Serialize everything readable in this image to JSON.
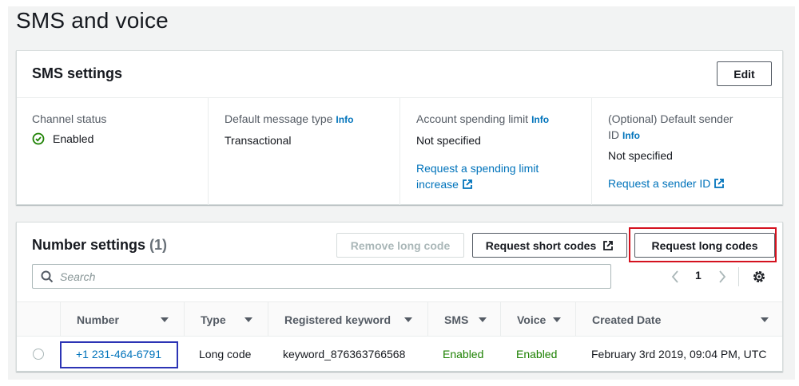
{
  "page": {
    "title": "SMS and voice"
  },
  "sms_settings": {
    "title": "SMS settings",
    "edit_label": "Edit",
    "channel_status": {
      "label": "Channel status",
      "value": "Enabled"
    },
    "default_message_type": {
      "label": "Default message type",
      "info": "Info",
      "value": "Transactional"
    },
    "spending_limit": {
      "label": "Account spending limit",
      "info": "Info",
      "value": "Not specified",
      "link_line1": "Request a spending limit",
      "link_line2": "increase"
    },
    "sender_id": {
      "label_line1": "(Optional) Default sender",
      "label_line2": "ID",
      "info": "Info",
      "value": "Not specified",
      "link": "Request a sender ID"
    }
  },
  "number_settings": {
    "title": "Number settings",
    "count": "(1)",
    "remove_label": "Remove long code",
    "request_short_label": "Request short codes",
    "request_long_label": "Request long codes",
    "search_placeholder": "Search",
    "page": "1",
    "columns": [
      "Number",
      "Type",
      "Registered keyword",
      "SMS",
      "Voice",
      "Created Date"
    ],
    "rows": [
      {
        "number": "+1 231-464-6791",
        "type": "Long code",
        "keyword": "keyword_876363766568",
        "sms": "Enabled",
        "voice": "Enabled",
        "created": "February 3rd 2019, 09:04 PM, UTC"
      }
    ]
  },
  "colors": {
    "link": "#0073bb",
    "success": "#1d8102",
    "highlight_red": "#d4121f",
    "highlight_blue": "#2c34b5"
  }
}
